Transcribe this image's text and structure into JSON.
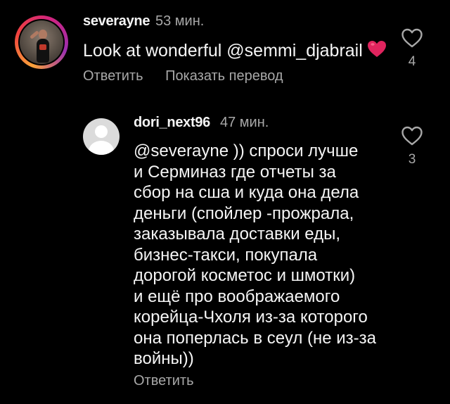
{
  "colors": {
    "background": "#000000",
    "primary_text": "#f5f5f5",
    "secondary_text": "#a8a8a8",
    "heart_emoji": "#e0245e",
    "story_ring": [
      "#f9a23a",
      "#f0413e",
      "#d1247e",
      "#9b2fb0"
    ]
  },
  "comments": [
    {
      "username": "severayne",
      "time": "53 мин.",
      "text": "Look at wonderful @semmi_djabrail",
      "emoji": "red-heart-icon",
      "avatar": "user-photo-avatar",
      "like_icon": "heart-outline-icon",
      "likes": "4",
      "actions": {
        "reply": "Ответить",
        "translate": "Показать перевод"
      }
    },
    {
      "username": "dori_next96",
      "time": "47 мин.",
      "avatar": "default-avatar-icon",
      "text_lines": [
        "@severayne )) спроси лучше",
        "и Серминаз где отчеты за",
        "сбор на сша и куда она дела",
        "деньги (спойлер -прожрала,",
        "заказывала доставки еды,",
        "бизнес-такси, покупала",
        "дорогой косметос и шмотки)",
        "и ещё про воображаемого",
        "корейца-Чхоля из-за которого",
        "она поперлась в сеул (не из-за",
        "войны))"
      ],
      "like_icon": "heart-outline-icon",
      "likes": "3",
      "actions": {
        "reply": "Ответить"
      }
    }
  ]
}
